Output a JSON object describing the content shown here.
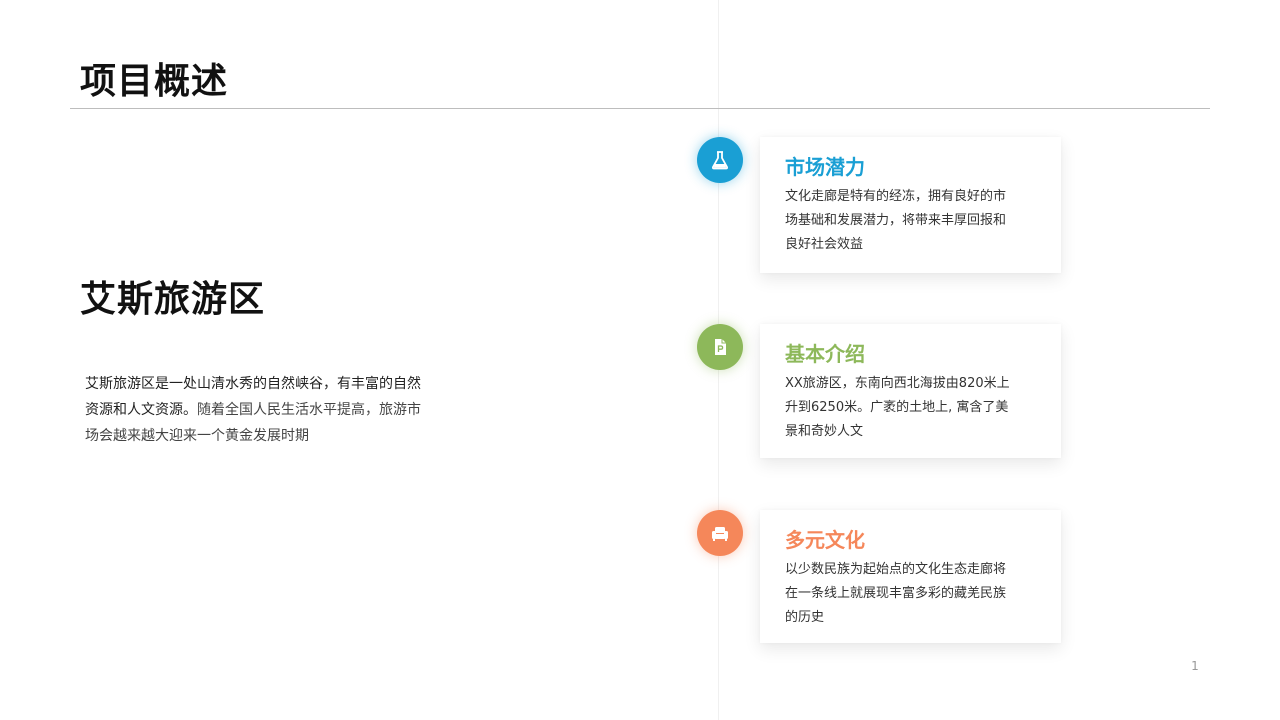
{
  "header": {
    "title": "项目概述"
  },
  "main": {
    "subtitle": "艾斯旅游区",
    "intro_part1": "艾斯旅游区是一处山清水秀的自然峡谷，有丰富的自然资源和人文资源。",
    "intro_part2": "随着全国人民生活水平提高，旅游市场会越来越大迎来一个黄金发展时期"
  },
  "cards": [
    {
      "title": "市场潜力",
      "text": "文化走廊是特有的经冻，拥有良好的市场基础和发展潜力，将带来丰厚回报和良好社会效益",
      "color": "#1a9fd4",
      "icon": "flask-icon"
    },
    {
      "title": "基本介绍",
      "text": "XX旅游区，东南向西北海拔由820米上升到6250米。广袤的土地上, 寓含了美景和奇妙人文",
      "color": "#8db85a",
      "icon": "document-icon"
    },
    {
      "title": "多元文化",
      "text": "以少数民族为起始点的文化生态走廊将在一条线上就展现丰富多彩的藏羌民族的历史",
      "color": "#f5875a",
      "icon": "sofa-icon"
    }
  ],
  "footer": {
    "page_number": "1"
  }
}
